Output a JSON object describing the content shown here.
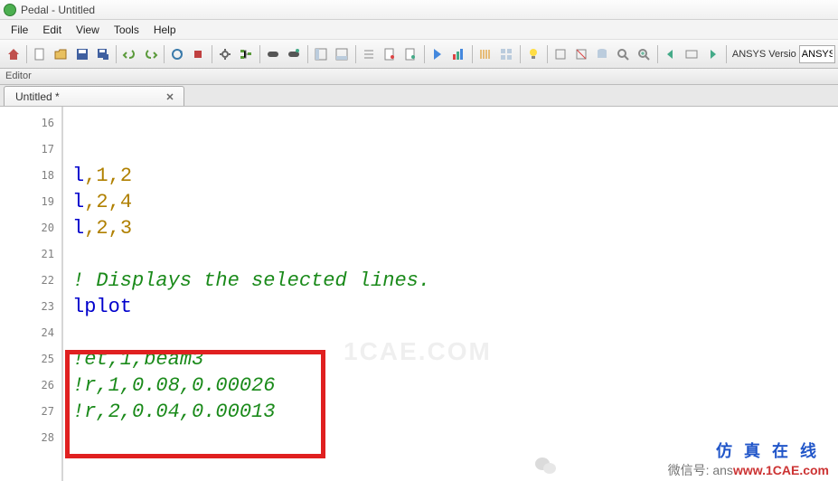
{
  "window": {
    "title": "Pedal - Untitled"
  },
  "menu": {
    "file": "File",
    "edit": "Edit",
    "view": "View",
    "tools": "Tools",
    "help": "Help"
  },
  "toolbar": {
    "ansys_label": "ANSYS Versio",
    "ansys_value": "ANSYS"
  },
  "panel": {
    "header": "Editor"
  },
  "tab": {
    "label": "Untitled *"
  },
  "gutter": {
    "l16": "16",
    "l17": "17",
    "l18": "18",
    "l19": "19",
    "l20": "20",
    "l21": "21",
    "l22": "22",
    "l23": "23",
    "l24": "24",
    "l25": "25",
    "l26": "26",
    "l27": "27",
    "l28": "28"
  },
  "code": {
    "l18": {
      "kw": "l",
      "c1": ",",
      "n1": "1",
      "c2": ",",
      "n2": "2"
    },
    "l19": {
      "kw": "l",
      "c1": ",",
      "n1": "2",
      "c2": ",",
      "n2": "4"
    },
    "l20": {
      "kw": "l",
      "c1": ",",
      "n1": "2",
      "c2": ",",
      "n2": "3"
    },
    "l22": "! Displays the selected lines.",
    "l23": "lplot",
    "l25": "!et,1,beam3",
    "l26": "!r,1,0.08,0.00026",
    "l27": "!r,2,0.04,0.00013"
  },
  "watermark": {
    "cn": "仿 真 在 线",
    "site_pre": "微信号: ans",
    "site_red": "www.1CAE.com",
    "center": "1CAE.COM"
  }
}
